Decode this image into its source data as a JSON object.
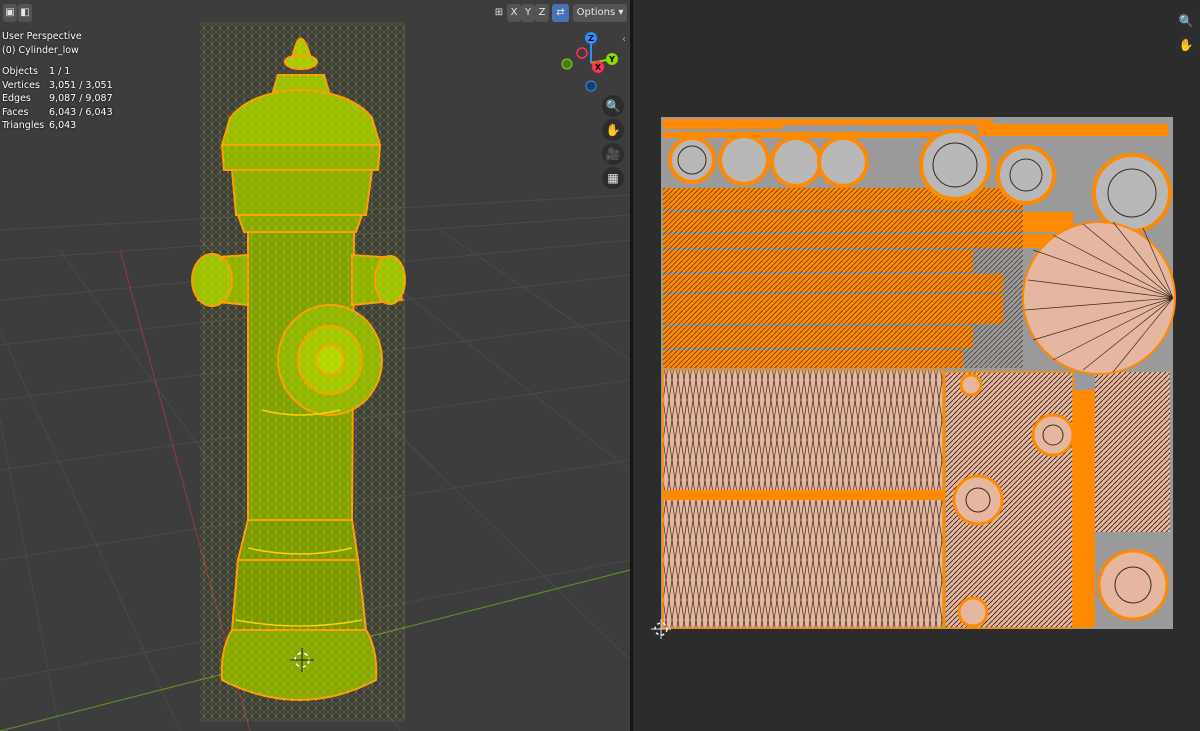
{
  "header": {
    "view_mode_icons": [
      "object-mode-icon",
      "overlay-icon"
    ],
    "mirror_axes": [
      "X",
      "Y",
      "Z"
    ],
    "options_label": "Options",
    "options_chevron": "▾"
  },
  "viewport": {
    "perspective_label": "User Perspective",
    "object_label": "(0) Cylinder_low",
    "stats": [
      {
        "label": "Objects",
        "value": "1 / 1"
      },
      {
        "label": "Vertices",
        "value": "3,051 / 3,051"
      },
      {
        "label": "Edges",
        "value": "9,087 / 9,087"
      },
      {
        "label": "Faces",
        "value": "6,043 / 6,043"
      },
      {
        "label": "Triangles",
        "value": "6,043"
      }
    ],
    "gizmo_axes": [
      "Z",
      "Y",
      "X"
    ],
    "nav_icons": [
      "zoom-icon",
      "hand-pan-icon",
      "camera-icon",
      "grid-ortho-icon"
    ]
  },
  "uv_editor": {
    "nav_icons": [
      "zoom-icon",
      "hand-pan-icon"
    ]
  },
  "colors": {
    "mesh_fill": "#8db600",
    "wire": "#ffd000",
    "uv_orange": "#ff8a00",
    "uv_fill": "#e8b8a2",
    "axis_x": "#ff3352",
    "axis_y": "#8bdc00",
    "axis_z": "#2c8fff"
  }
}
